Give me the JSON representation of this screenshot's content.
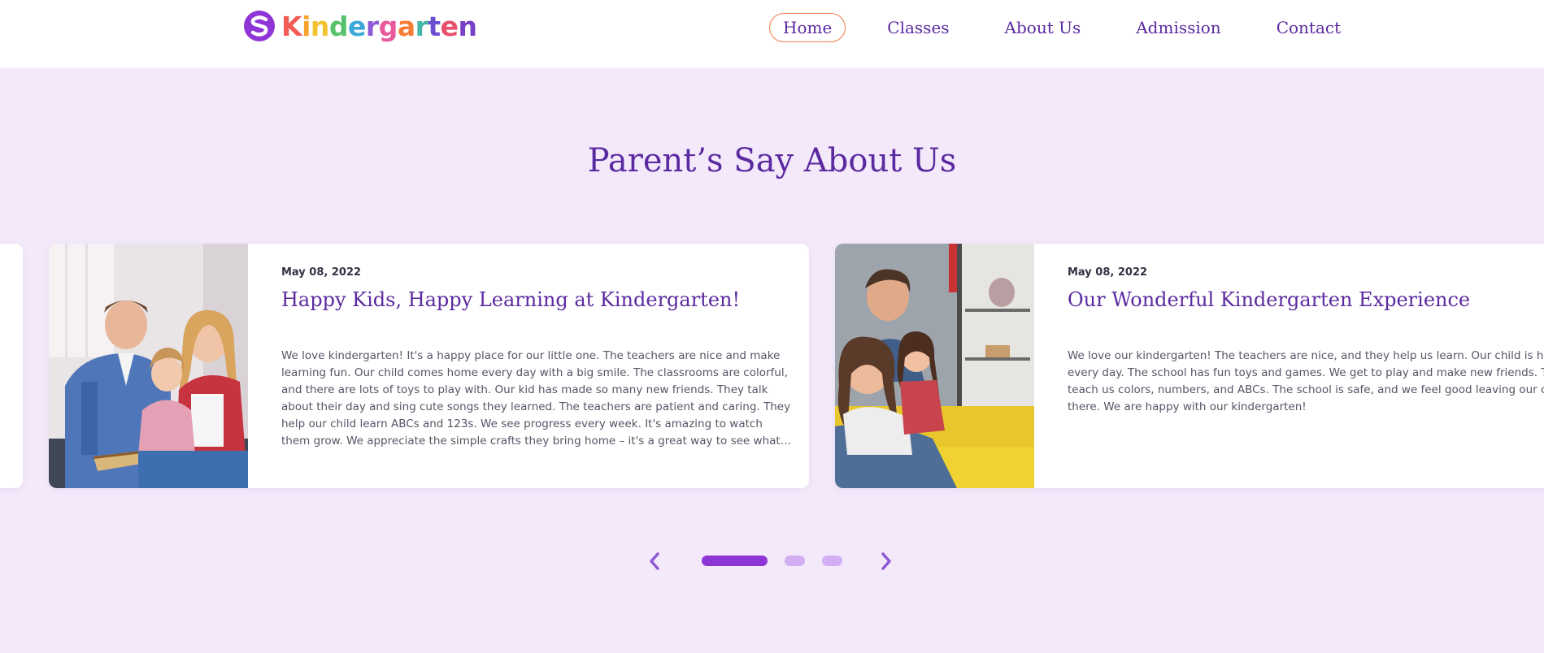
{
  "header": {
    "logo_text": "Kindergarten",
    "logo_letter_colors": [
      "#f25c54",
      "#f7a531",
      "#f2c230",
      "#57c26b",
      "#3aa8d8",
      "#8e5ad6",
      "#e95a9c",
      "#f57c34",
      "#45b7a8",
      "#6a4fd1",
      "#e84f6b",
      "#7a3fc7"
    ],
    "nav": [
      {
        "label": "Home",
        "active": true
      },
      {
        "label": "Classes",
        "active": false
      },
      {
        "label": "About Us",
        "active": false
      },
      {
        "label": "Admission",
        "active": false
      },
      {
        "label": "Contact",
        "active": false
      }
    ]
  },
  "section": {
    "title": "Parent’s Say About Us"
  },
  "testimonials": [
    {
      "date": "May 08, 2022",
      "title": "Happy Kids, Happy Learning at Kindergarten!",
      "text": "We love kindergarten! It's a happy place for our little one. The teachers are nice and make learning fun. Our child comes home every day with a big smile. The classrooms are colorful, and there are lots of toys to play with. Our kid has made so many new friends. They talk about their day and sing cute songs they learned. The teachers are patient and caring. They help our child learn ABCs and 123s. We see progress every week. It's amazing to watch them grow. We appreciate the simple crafts they bring home – it's a great way to see what they're learning. The...",
      "image": "family-photo-reading"
    },
    {
      "date": "May 08, 2022",
      "title": "Our Wonderful Kindergarten Experience",
      "text": "We love our kindergarten! The teachers are nice, and they help us learn. Our child is happy every day. The school has fun toys and games. We get to play and make new friends. They teach us colors, numbers, and ABCs. The school is safe, and we feel good leaving our child there. We are happy with our kindergarten!",
      "image": "family-photo-sofa"
    }
  ],
  "slider": {
    "prev_icon": "chevron-left-icon",
    "next_icon": "chevron-right-icon",
    "dot_count": 3,
    "active_dot": 1
  },
  "colors": {
    "brand_purple": "#5b2aa0",
    "accent_purple": "#8e35d6",
    "dot_inactive": "#d4aef2",
    "nav_active_border": "#ef7a45",
    "section_bg": "#f3e9fa"
  }
}
